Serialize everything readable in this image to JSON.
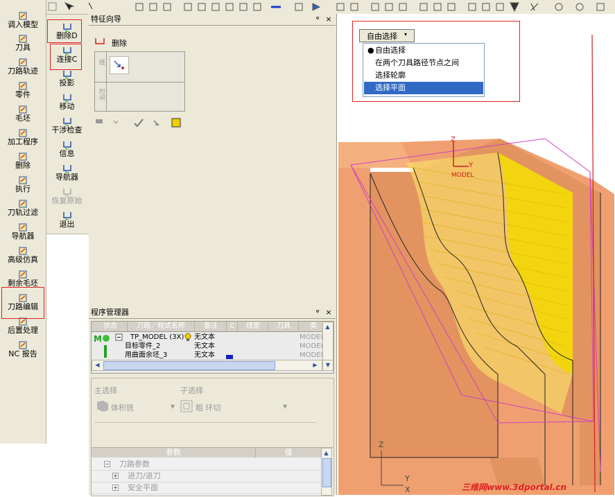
{
  "left_toolbar": {
    "items": [
      {
        "label": "调入模型",
        "icon": "import-model-icon"
      },
      {
        "label": "刀具",
        "icon": "tool-icon"
      },
      {
        "label": "刀路轨迹",
        "icon": "toolpath-icon"
      },
      {
        "label": "零件",
        "icon": "part-icon"
      },
      {
        "label": "毛坯",
        "icon": "stock-icon"
      },
      {
        "label": "加工程序",
        "icon": "machining-program-icon"
      },
      {
        "label": "删除",
        "icon": "delete-icon"
      },
      {
        "label": "执行",
        "icon": "execute-icon"
      },
      {
        "label": "刀轨过滤",
        "icon": "toolpath-filter-icon"
      },
      {
        "label": "导航器",
        "icon": "navigator-icon"
      },
      {
        "label": "高级仿真",
        "icon": "advanced-simulation-icon"
      },
      {
        "label": "剩余毛坯",
        "icon": "remaining-stock-icon"
      },
      {
        "label": "刀路编辑",
        "icon": "toolpath-edit-icon"
      },
      {
        "label": "后置处理",
        "icon": "post-process-icon"
      },
      {
        "label": "NC 报告",
        "icon": "nc-report-icon"
      }
    ]
  },
  "edit_toolbar": {
    "items": [
      {
        "label": "删除D",
        "icon": "delete-icon"
      },
      {
        "label": "连接C",
        "icon": "connect-icon"
      },
      {
        "label": "投影",
        "icon": "project-icon"
      },
      {
        "label": "移动",
        "icon": "move-icon"
      },
      {
        "label": "干涉检查",
        "icon": "interference-check-icon"
      },
      {
        "label": "信息",
        "icon": "info-icon"
      },
      {
        "label": "导航器",
        "icon": "navigator-icon"
      },
      {
        "label": "恢复原始",
        "icon": "restore-icon"
      },
      {
        "label": "退出",
        "icon": "exit-icon"
      }
    ]
  },
  "feature_wizard": {
    "title": "特征向导",
    "delete_label": "删除",
    "box1_label": "链",
    "box2_label": "时间",
    "pin": "ᵠ",
    "close": "×"
  },
  "program_manager": {
    "title": "程序管理器",
    "columns": [
      "状态",
      "刀路／程式名称",
      "备注",
      "C",
      "线宽",
      "刀具",
      "类"
    ],
    "rows": [
      {
        "name": "TP_MODEL (3X)",
        "note": "无文本",
        "type": "MODEL"
      },
      {
        "name": "目标零件_2",
        "note": "无文本",
        "type": "MODEL"
      },
      {
        "name": "用曲面余坯_3",
        "note": "无文本",
        "type": "MODEL"
      }
    ]
  },
  "params_panel": {
    "main_select_label": "主选择",
    "sub_select_label": "子选择",
    "main_value": "体积铣",
    "sub_value": "粗 环切",
    "header_param": "参数",
    "header_value": "值",
    "rows": [
      "刀路参数",
      "进刀/退刀",
      "安全平面"
    ]
  },
  "viewport": {
    "dropdown_value": "自由选择",
    "menu_items": [
      "自由选择",
      "在两个刀具路径节点之间",
      "选择轮廓",
      "选择平面"
    ],
    "selected_index": 3,
    "axis_z": "Z",
    "axis_y": "Y",
    "axis_x": "X",
    "model_label": "MODEL",
    "watermark": "三维网www.3dportal.cn"
  },
  "colors": {
    "model_orange": "#f0a070",
    "highlight_yellow": "#f5e000",
    "select_blue": "#316ac5",
    "red_box": "#e02020",
    "magenta": "#d040c0"
  }
}
